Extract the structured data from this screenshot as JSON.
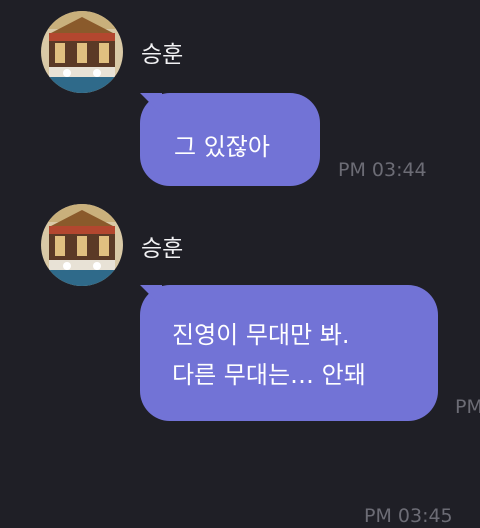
{
  "messages": [
    {
      "sender": "승훈",
      "avatar_icon": "carousel-avatar-icon",
      "text": "그 있잖아",
      "time": "PM 03:44"
    },
    {
      "sender": "승훈",
      "avatar_icon": "carousel-avatar-icon",
      "text": "진영이 무대만 봐.\n다른 무대는… 안돼",
      "time": "PM"
    }
  ],
  "bottom_time": "PM 03:45",
  "colors": {
    "background": "#1f1f26",
    "bubble": "#7273d6",
    "time": "#6c6c75"
  }
}
